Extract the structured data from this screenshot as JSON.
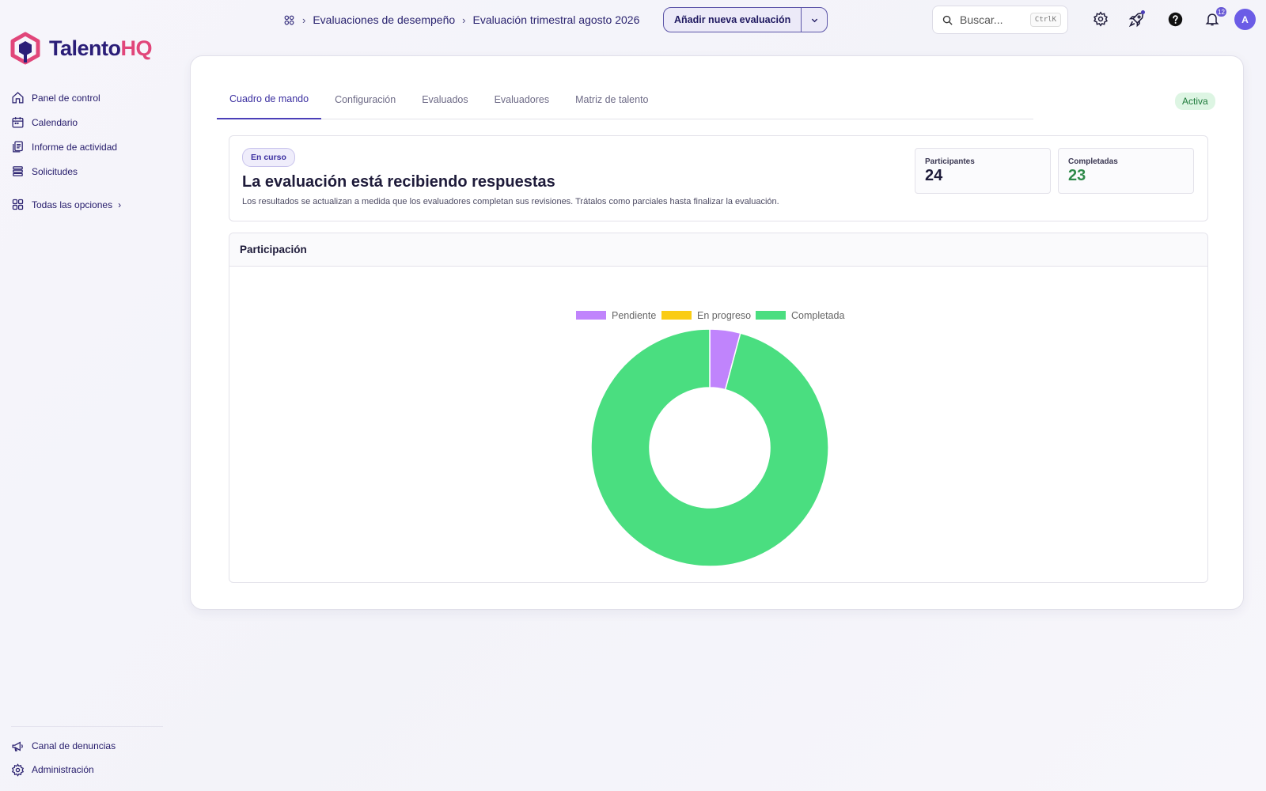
{
  "brand": {
    "name_main": "Talento",
    "name_accent": "HQ"
  },
  "sidebar": {
    "items": [
      {
        "label": "Panel de control",
        "icon": "home-icon"
      },
      {
        "label": "Calendario",
        "icon": "calendar-icon"
      },
      {
        "label": "Informe de actividad",
        "icon": "report-icon"
      },
      {
        "label": "Solicitudes",
        "icon": "list-icon"
      }
    ],
    "all_options": {
      "label": "Todas las opciones",
      "icon": "grid-icon"
    },
    "bottom": [
      {
        "label": "Canal de denuncias",
        "icon": "megaphone-icon"
      },
      {
        "label": "Administración",
        "icon": "gear-icon"
      }
    ]
  },
  "header": {
    "breadcrumb": [
      "Evaluaciones de desempeño",
      "Evaluación trimestral agosto 2026"
    ],
    "add_button": "Añadir nueva evaluación",
    "search": {
      "placeholder": "Buscar...",
      "shortcut": "CtrlK"
    },
    "notifications_count": "12",
    "avatar_initial": "A"
  },
  "tabs": [
    {
      "label": "Cuadro de mando",
      "active": true
    },
    {
      "label": "Configuración",
      "active": false
    },
    {
      "label": "Evaluados",
      "active": false
    },
    {
      "label": "Evaluadores",
      "active": false
    },
    {
      "label": "Matriz de talento",
      "active": false
    }
  ],
  "status": "Activa",
  "banner": {
    "chip": "En curso",
    "title": "La evaluación está recibiendo respuestas",
    "description": "Los resultados se actualizan a medida que los evaluadores completan sus revisiones. Trátalos como parciales hasta finalizar la evaluación.",
    "stats": [
      {
        "label": "Participantes",
        "value": "24"
      },
      {
        "label": "Completadas",
        "value": "23"
      }
    ]
  },
  "participation": {
    "title": "Participación"
  },
  "chart_data": {
    "type": "pie",
    "variant": "donut",
    "categories": [
      "Pendiente",
      "En progreso",
      "Completada"
    ],
    "values": [
      1,
      0,
      23
    ],
    "colors": [
      "#c084fc",
      "#facc15",
      "#4ade80"
    ],
    "legend": "top"
  }
}
